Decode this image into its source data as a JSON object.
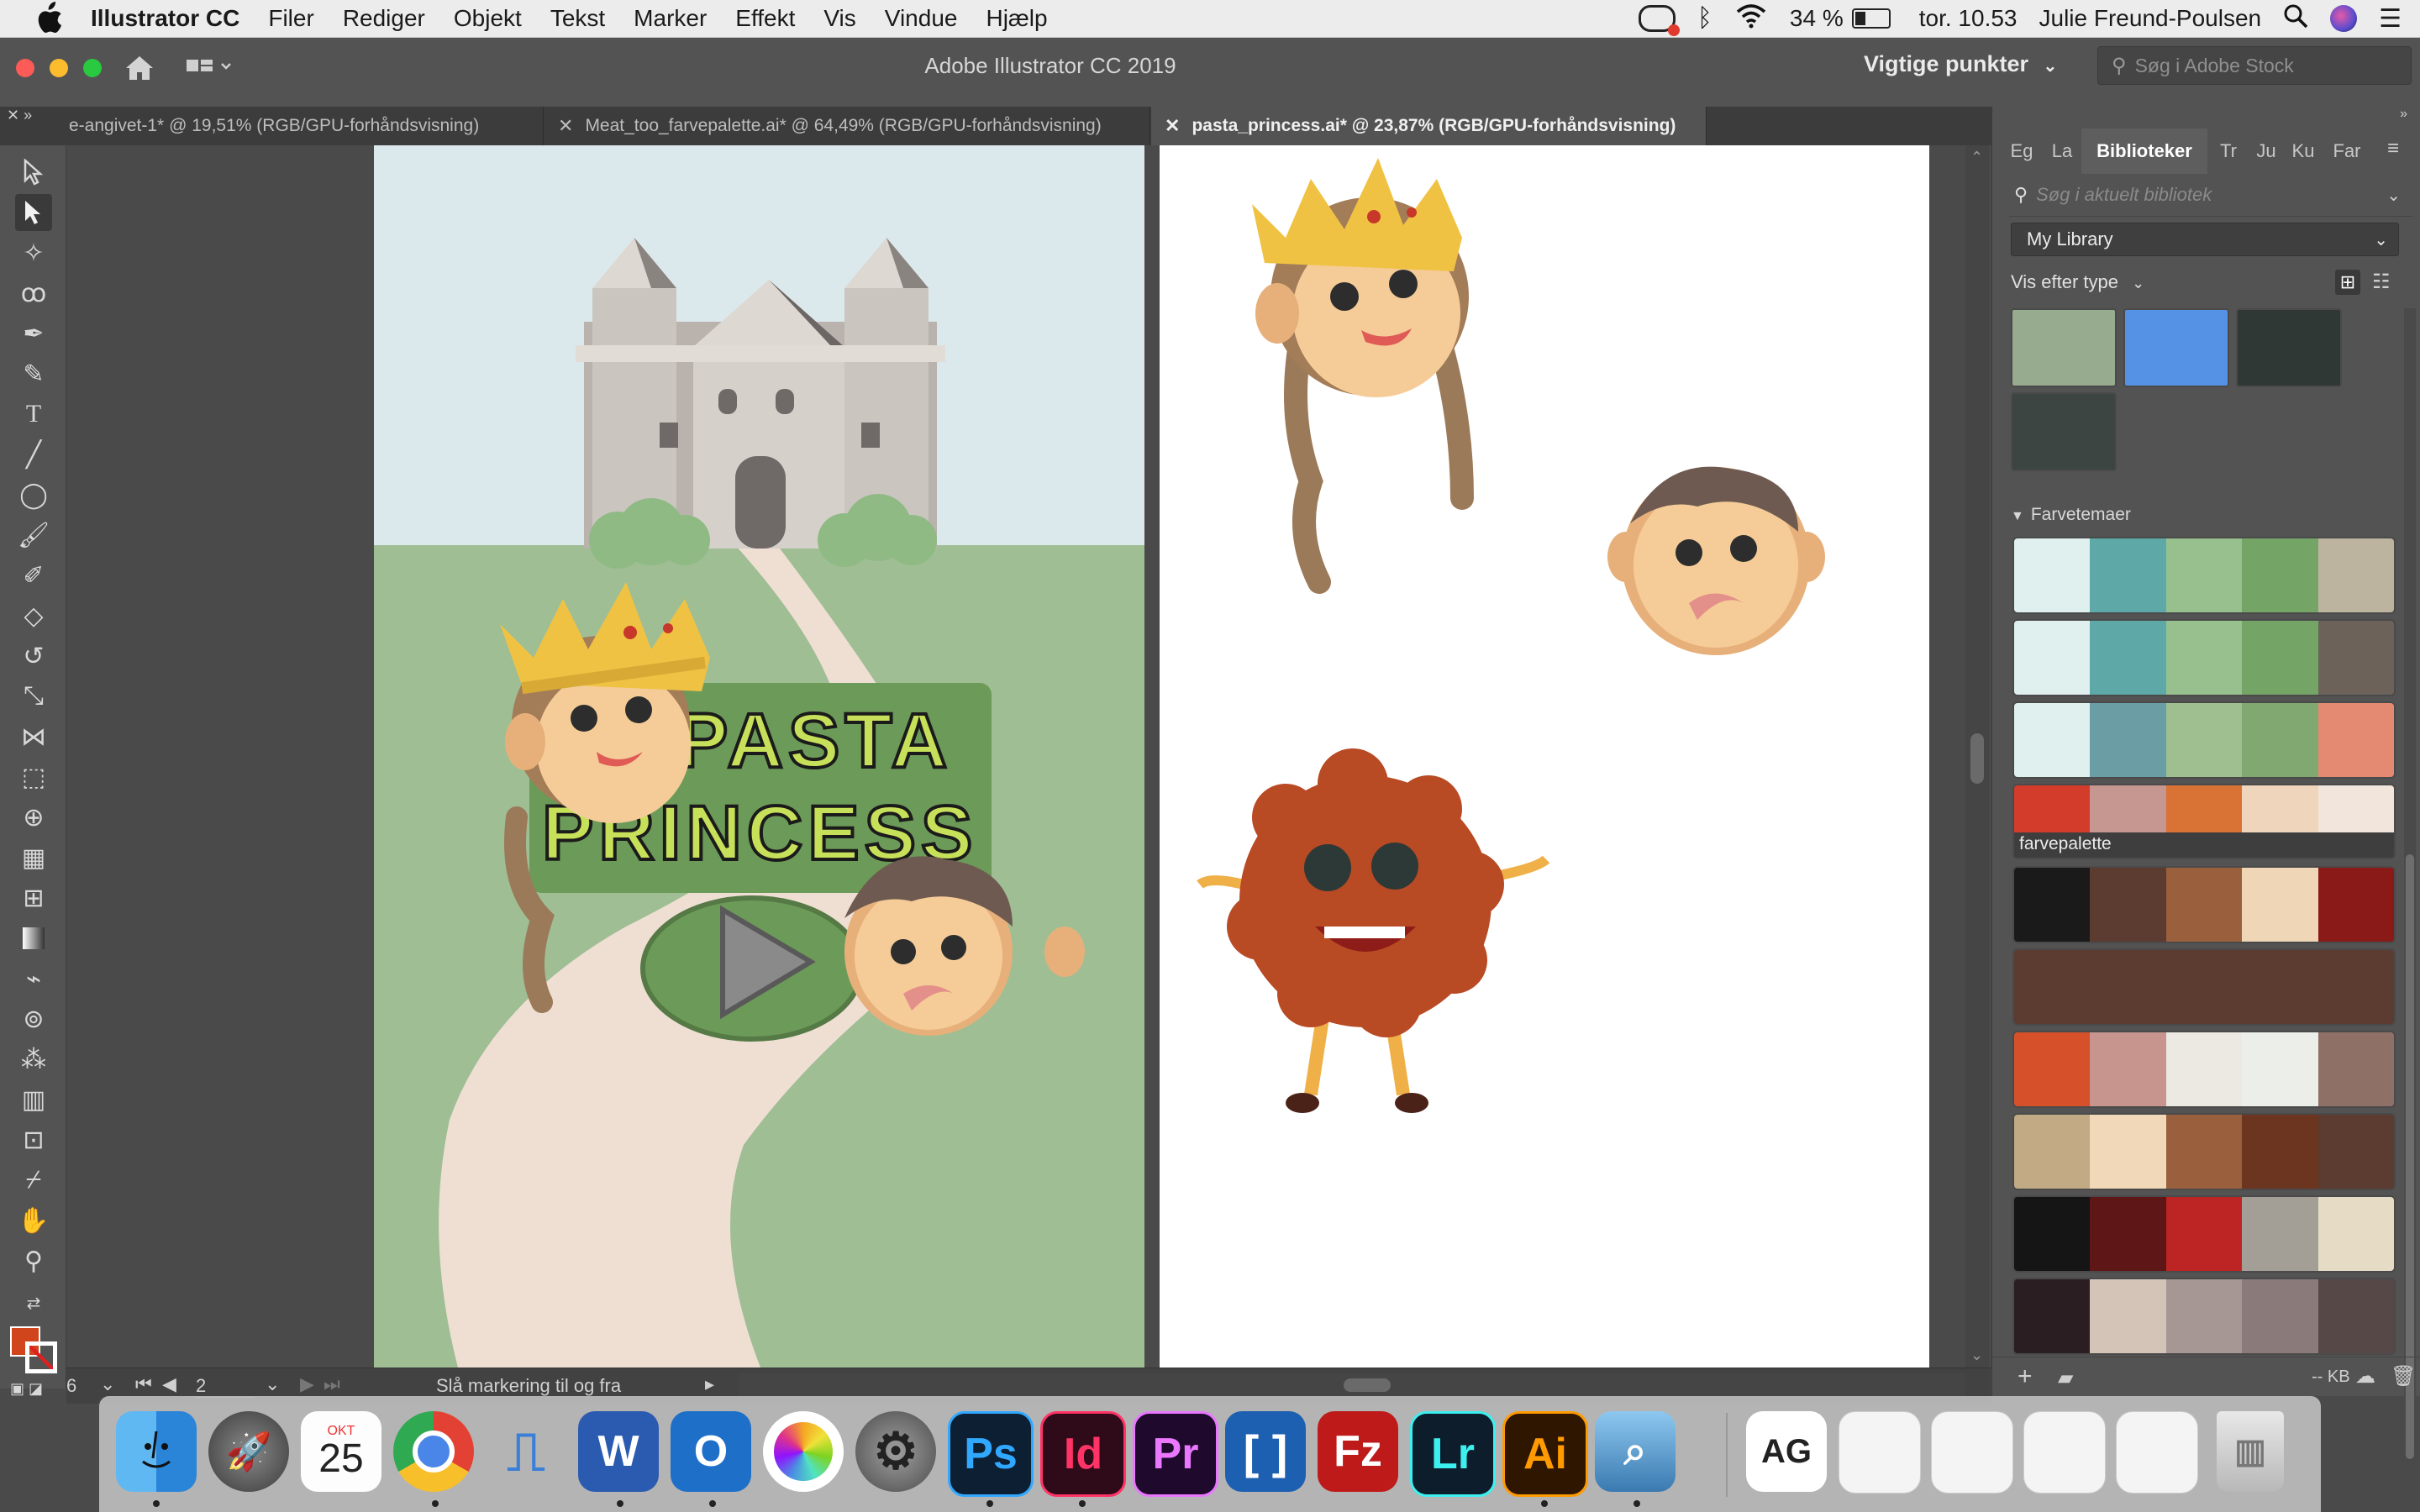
{
  "menubar": {
    "app_name": "Illustrator CC",
    "items": [
      "Filer",
      "Rediger",
      "Objekt",
      "Tekst",
      "Marker",
      "Effekt",
      "Vis",
      "Vindue",
      "Hjælp"
    ],
    "battery": "34 %",
    "clock": "tor. 10.53",
    "user": "Julie Freund-Poulsen"
  },
  "titlebar": {
    "title": "Adobe Illustrator CC 2019",
    "workspace": "Vigtige punkter",
    "stock_placeholder": "Søg i Adobe Stock"
  },
  "tabs": [
    {
      "label": "e-angivet-1* @ 19,51% (RGB/GPU-forhåndsvisning)"
    },
    {
      "label": "Meat_too_farvepalette.ai* @ 64,49% (RGB/GPU-forhåndsvisning)"
    },
    {
      "label": "pasta_princess.ai* @ 23,87% (RGB/GPU-forhåndsvisning)"
    }
  ],
  "artboard": {
    "title_line1": "PASTA",
    "title_line2": "PRINCESS"
  },
  "status": {
    "zoom_fragment": "6",
    "artboard_number": "2",
    "toggle_label": "Slå markering til og fra"
  },
  "panel": {
    "tabs": [
      "Eg",
      "La",
      "Biblioteker",
      "Tr",
      "Ju",
      "Ku",
      "Far"
    ],
    "search_placeholder": "Søg i aktuelt bibliotek",
    "library": "My Library",
    "view_by": "Vis efter type",
    "section_label": "Farvetemaer",
    "swatches": [
      "#97ab8e",
      "#5592e6",
      "#2f3835",
      "#3c4542"
    ],
    "themes": [
      {
        "label": "",
        "colors": [
          "#dff0ef",
          "#5ea8a8",
          "#98c08f",
          "#74a566",
          "#bdb4a0"
        ]
      },
      {
        "label": "",
        "colors": [
          "#dff0ef",
          "#5ea8a8",
          "#98c08f",
          "#74a566",
          "#6c625a"
        ]
      },
      {
        "label": "",
        "colors": [
          "#dff0ef",
          "#6a9ea4",
          "#a0bf91",
          "#80a870",
          "#e48a72"
        ]
      },
      {
        "label": "farvepalette",
        "colors": [
          "#d33c2a",
          "#c59790",
          "#d87235",
          "#eed5bb",
          "#f2e5dc"
        ]
      },
      {
        "label": "",
        "colors": [
          "#1a1a1a",
          "#5c3b30",
          "#9a5f3c",
          "#efd6b6",
          "#8a1a18"
        ]
      },
      {
        "label": "",
        "colors": [
          "#5c3b30"
        ]
      },
      {
        "label": "",
        "colors": [
          "#d6502a",
          "#c8958e",
          "#ebe9e2",
          "#eceeea",
          "#8f7067"
        ]
      },
      {
        "label": "",
        "colors": [
          "#c2aa84",
          "#f1d8b8",
          "#9a5f3c",
          "#6b3520",
          "#5c3b30"
        ]
      },
      {
        "label": "",
        "colors": [
          "#151515",
          "#5e1616",
          "#bc2523",
          "#a39f96",
          "#e6dcc6"
        ]
      },
      {
        "label": "",
        "colors": [
          "#2a1e22",
          "#d4c4b8",
          "#a69694",
          "#8a7a7a",
          "#574848"
        ]
      }
    ],
    "footer_kb": "-- KB"
  },
  "dock": {
    "calendar_month": "OKT",
    "calendar_day": "25",
    "apps": [
      "Finder",
      "Launchpad",
      "Calendar",
      "Chrome",
      "Keynote",
      "Word",
      "Outlook",
      "Photos",
      "System Preferences",
      "Ps",
      "Id",
      "Pr",
      "Brackets",
      "FileZilla",
      "Lr",
      "Ai",
      "Preview"
    ]
  },
  "colors": {
    "accent": "#d0451c",
    "sky": "#dce9ec",
    "grass": "#9fbe94",
    "path": "#efdfd3"
  }
}
